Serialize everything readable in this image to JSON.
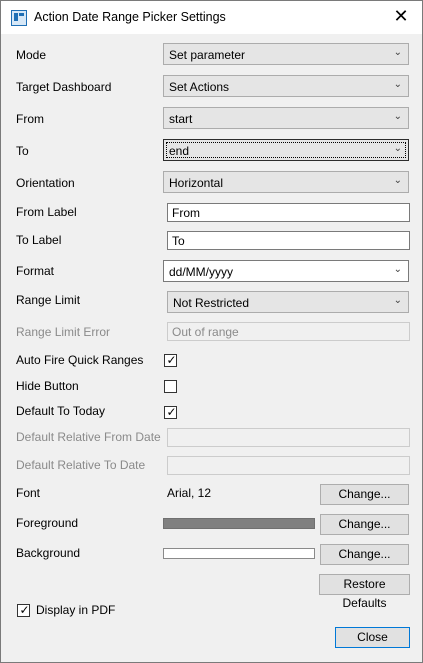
{
  "window": {
    "title": "Action Date Range Picker Settings",
    "close_glyph": "✕"
  },
  "rows": {
    "mode": {
      "label": "Mode",
      "value": "Set parameter"
    },
    "target_dashboard": {
      "label": "Target Dashboard",
      "value": "Set Actions"
    },
    "from": {
      "label": "From",
      "value": "start"
    },
    "to": {
      "label": "To",
      "value": "end"
    },
    "orientation": {
      "label": "Orientation",
      "value": "Horizontal"
    },
    "from_label": {
      "label": "From Label",
      "value": "From"
    },
    "to_label": {
      "label": "To Label",
      "value": "To"
    },
    "format": {
      "label": "Format",
      "value": "dd/MM/yyyy"
    },
    "range_limit": {
      "label": "Range Limit",
      "value": "Not Restricted"
    },
    "range_limit_error": {
      "label": "Range Limit Error",
      "value": "Out of range"
    },
    "auto_fire": {
      "label": "Auto Fire Quick Ranges",
      "checked": true
    },
    "hide_button": {
      "label": "Hide Button",
      "checked": false
    },
    "default_today": {
      "label": "Default To Today",
      "checked": true
    },
    "default_rel_from": {
      "label": "Default Relative From Date",
      "value": ""
    },
    "default_rel_to": {
      "label": "Default Relative To Date",
      "value": ""
    },
    "font": {
      "label": "Font",
      "value": "Arial, 12",
      "button": "Change..."
    },
    "foreground": {
      "label": "Foreground",
      "color": "#808080",
      "button": "Change..."
    },
    "background": {
      "label": "Background",
      "color": "#ffffff",
      "button": "Change..."
    }
  },
  "restore_defaults": "Restore Defaults",
  "display_pdf": {
    "label": "Display in PDF",
    "checked": true
  },
  "close_button": "Close",
  "checkmark": "✓",
  "chevron": "⌄"
}
